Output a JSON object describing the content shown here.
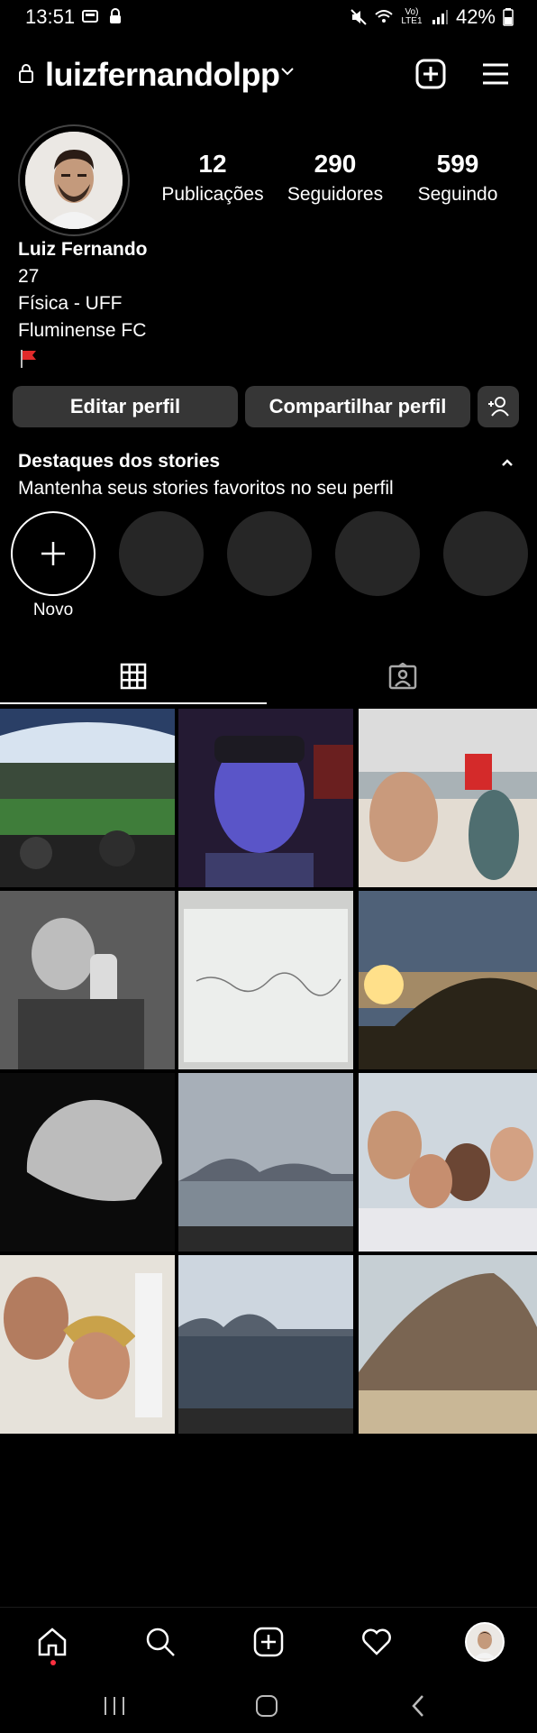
{
  "status_bar": {
    "time": "13:51",
    "battery": "42%",
    "network_label": "Vo) LTE1"
  },
  "header": {
    "username": "luizfernandolpp"
  },
  "profile": {
    "stats": [
      {
        "value": "12",
        "label": "Publicações"
      },
      {
        "value": "290",
        "label": "Seguidores"
      },
      {
        "value": "599",
        "label": "Seguindo"
      }
    ],
    "bio": {
      "name": "Luiz Fernando",
      "lines": [
        "27",
        "Física - UFF",
        "Fluminense FC"
      ]
    }
  },
  "actions": {
    "edit_label": "Editar perfil",
    "share_label": "Compartilhar perfil"
  },
  "highlights": {
    "title": "Destaques dos stories",
    "subtitle": "Mantenha seus stories favoritos no seu perfil",
    "new_label": "Novo"
  },
  "tabs": [
    "grid-icon",
    "tagged-icon"
  ],
  "posts": [
    {
      "name": "post-stadium"
    },
    {
      "name": "post-face-paint"
    },
    {
      "name": "post-beach-selfie"
    },
    {
      "name": "post-bw-drink"
    },
    {
      "name": "post-whiteboard"
    },
    {
      "name": "post-sunset-hill"
    },
    {
      "name": "post-moon"
    },
    {
      "name": "post-bay-view"
    },
    {
      "name": "post-group-selfie"
    },
    {
      "name": "post-selfie-mother"
    },
    {
      "name": "post-sea-mountains"
    },
    {
      "name": "post-beach-mountain"
    }
  ],
  "colors": {
    "background": "#000000",
    "button": "#363636",
    "empty_highlight": "#262626",
    "notification_dot": "#ff3040"
  }
}
